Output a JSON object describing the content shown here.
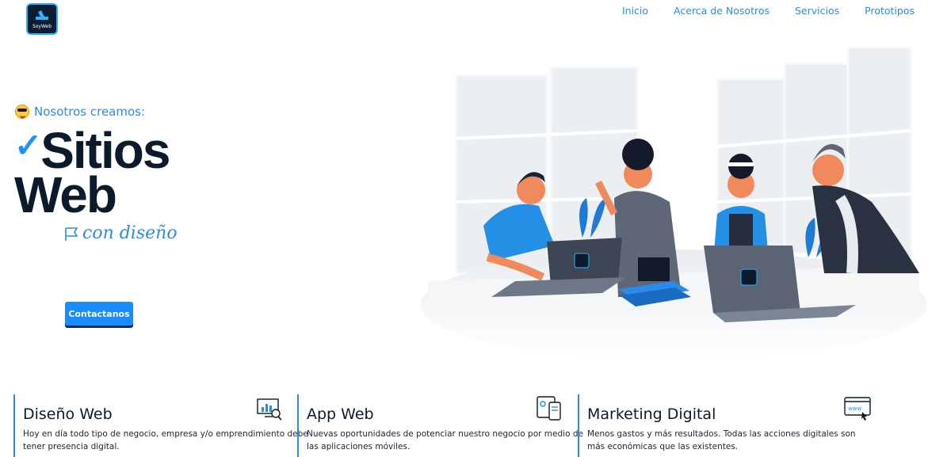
{
  "header": {
    "logo_text": "SoyWeb",
    "nav": [
      "Inicio",
      "Acerca de Nosotros",
      "Servicios",
      "Prototipos"
    ]
  },
  "hero": {
    "tagline": "Nosotros creamos:",
    "headline_line1": "Sitios",
    "headline_line2": "Web",
    "subline": "con diseño",
    "cta_label": "Contactanos"
  },
  "services": [
    {
      "title": "Diseño Web",
      "description": "Hoy en día todo tipo de negocio, empresa y/o emprendimiento debe tener presencia digital.",
      "icon": "analytics-monitor-icon"
    },
    {
      "title": "App Web",
      "description": "Nuevas oportunidades de potenciar nuestro negocio por medio de las aplicaciones móviles.",
      "icon": "devices-icon"
    },
    {
      "title": "Marketing Digital",
      "description": "Menos gastos y más resultados. Todas las acciones digitales son más económicas que las existentes.",
      "icon": "browser-www-icon"
    }
  ],
  "colors": {
    "accent": "#2b8be8",
    "button": "#1a8cff",
    "dark": "#0c1a2c"
  }
}
